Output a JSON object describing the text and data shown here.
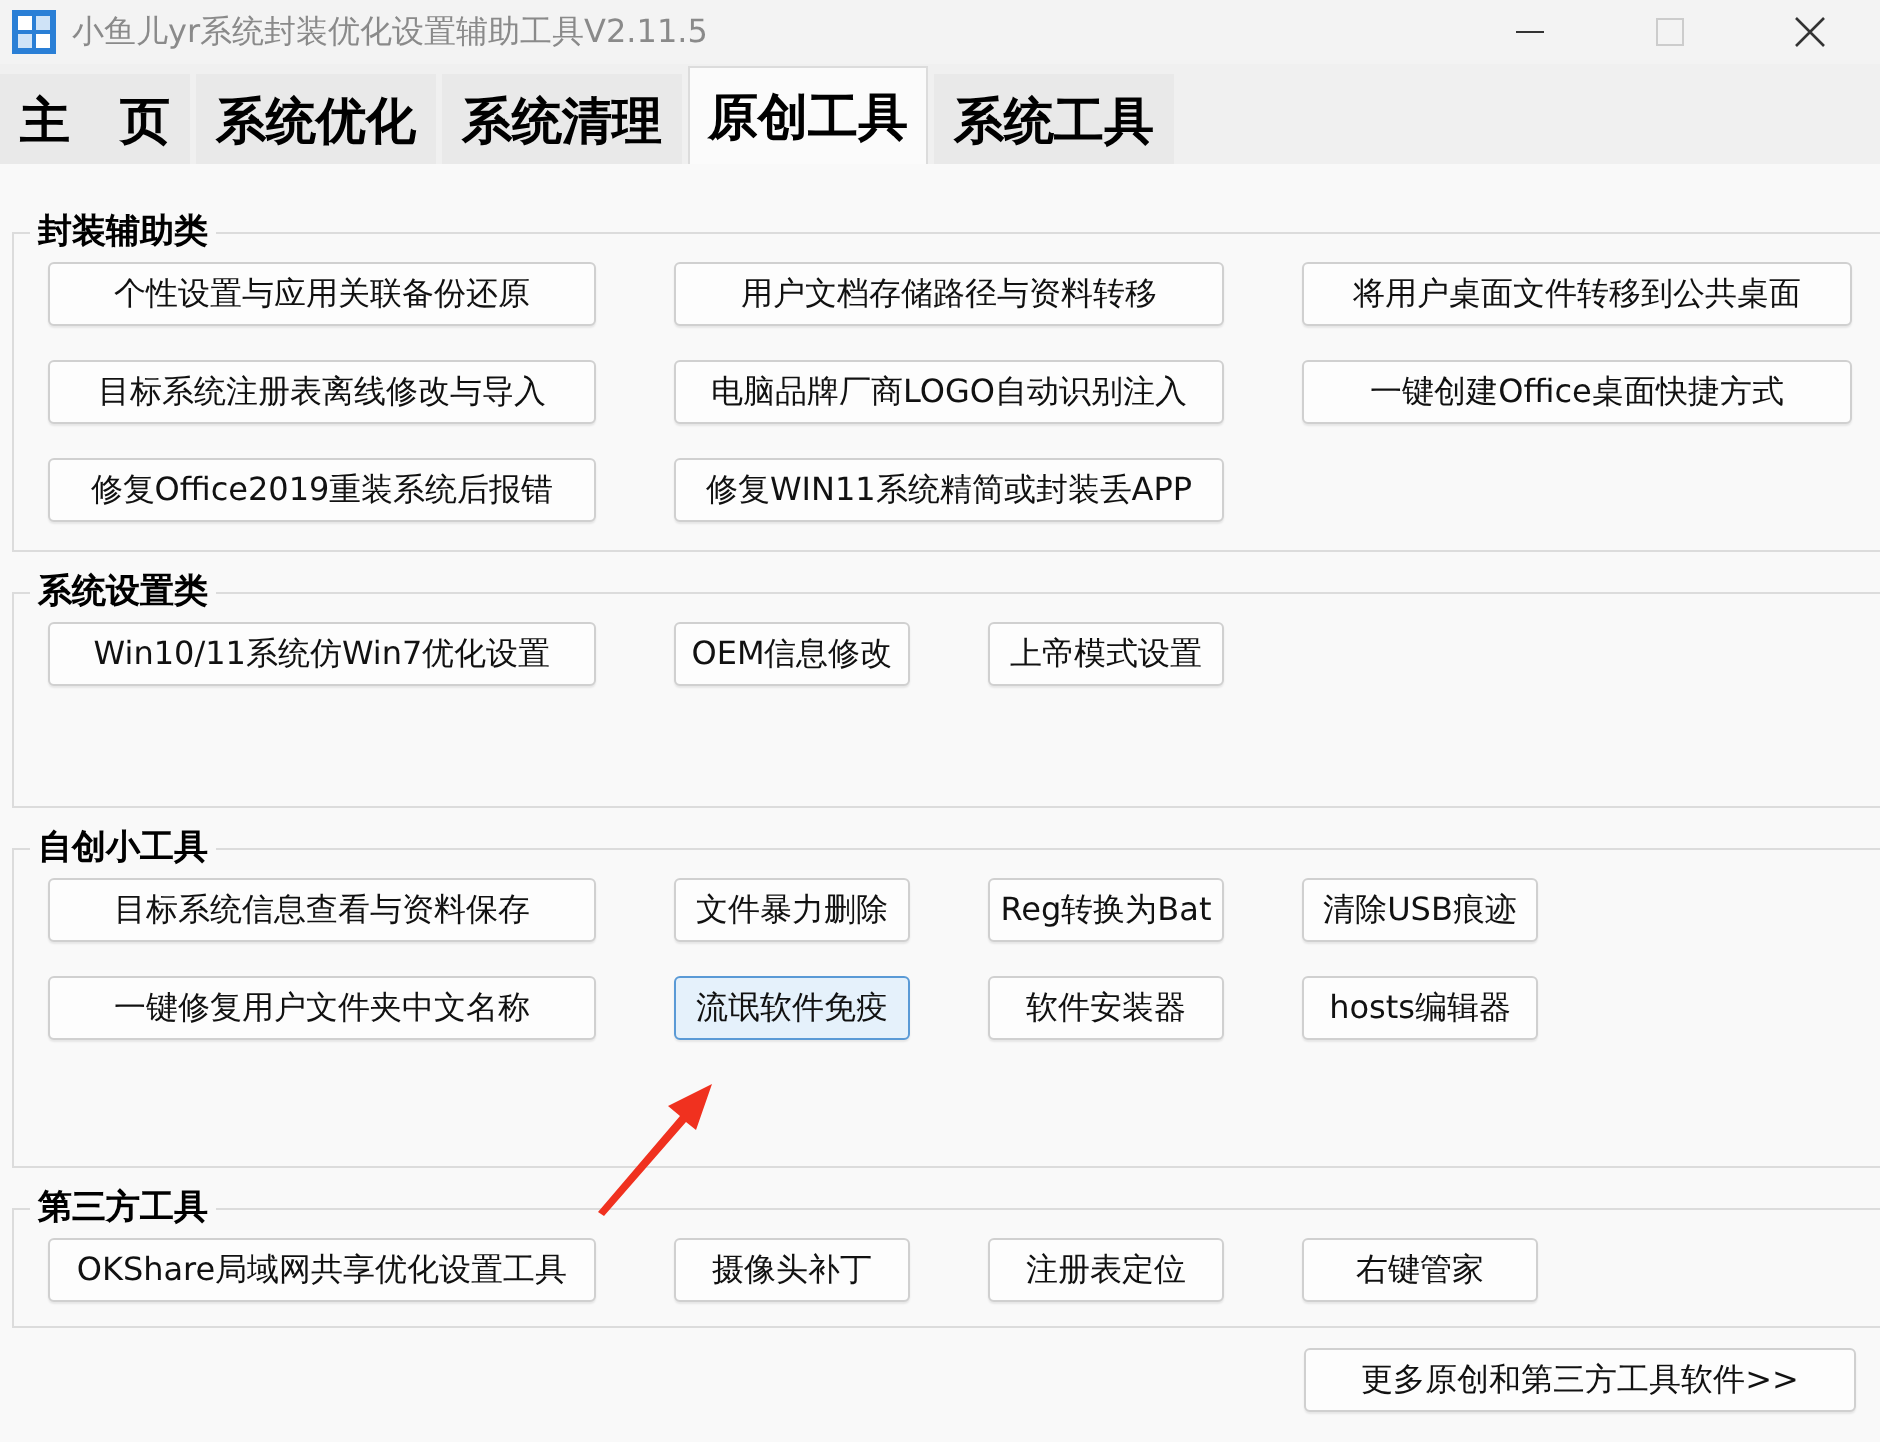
{
  "window": {
    "title": "小鱼儿yr系统封装优化设置辅助工具V2.11.5"
  },
  "tabs": [
    {
      "label": "主　页",
      "selected": false
    },
    {
      "label": "系统优化",
      "selected": false
    },
    {
      "label": "系统清理",
      "selected": false
    },
    {
      "label": "原创工具",
      "selected": true
    },
    {
      "label": "系统工具",
      "selected": false
    }
  ],
  "sections": [
    {
      "title": "封装辅助类",
      "rows": [
        [
          {
            "label": "个性设置与应用关联备份还原",
            "focused": false
          },
          {
            "label": "用户文档存储路径与资料转移",
            "focused": false
          },
          {
            "label": "将用户桌面文件转移到公共桌面",
            "focused": false
          }
        ],
        [
          {
            "label": "目标系统注册表离线修改与导入",
            "focused": false
          },
          {
            "label": "电脑品牌厂商LOGO自动识别注入",
            "focused": false
          },
          {
            "label": "一键创建Office桌面快捷方式",
            "focused": false
          }
        ],
        [
          {
            "label": "修复Office2019重装系统后报错",
            "focused": false
          },
          {
            "label": "修复WIN11系统精简或封装丢APP",
            "focused": false
          }
        ]
      ]
    },
    {
      "title": "系统设置类",
      "rows": [
        [
          {
            "label": "Win10/11系统仿Win7优化设置",
            "focused": false
          },
          {
            "label": "OEM信息修改",
            "focused": false
          },
          {
            "label": "上帝模式设置",
            "focused": false
          }
        ]
      ]
    },
    {
      "title": "自创小工具",
      "rows": [
        [
          {
            "label": "目标系统信息查看与资料保存",
            "focused": false
          },
          {
            "label": "文件暴力删除",
            "focused": false
          },
          {
            "label": "Reg转换为Bat",
            "focused": false
          },
          {
            "label": "清除USB痕迹",
            "focused": false
          }
        ],
        [
          {
            "label": "一键修复用户文件夹中文名称",
            "focused": false
          },
          {
            "label": "流氓软件免疫",
            "focused": true
          },
          {
            "label": "软件安装器",
            "focused": false
          },
          {
            "label": "hosts编辑器",
            "focused": false
          }
        ]
      ]
    },
    {
      "title": "第三方工具",
      "rows": [
        [
          {
            "label": "OKShare局域网共享优化设置工具",
            "focused": false
          },
          {
            "label": "摄像头补丁",
            "focused": false
          },
          {
            "label": "注册表定位",
            "focused": false
          },
          {
            "label": "右键管家",
            "focused": false
          }
        ]
      ]
    }
  ],
  "footer_button": {
    "label": "更多原创和第三方工具软件>>"
  }
}
